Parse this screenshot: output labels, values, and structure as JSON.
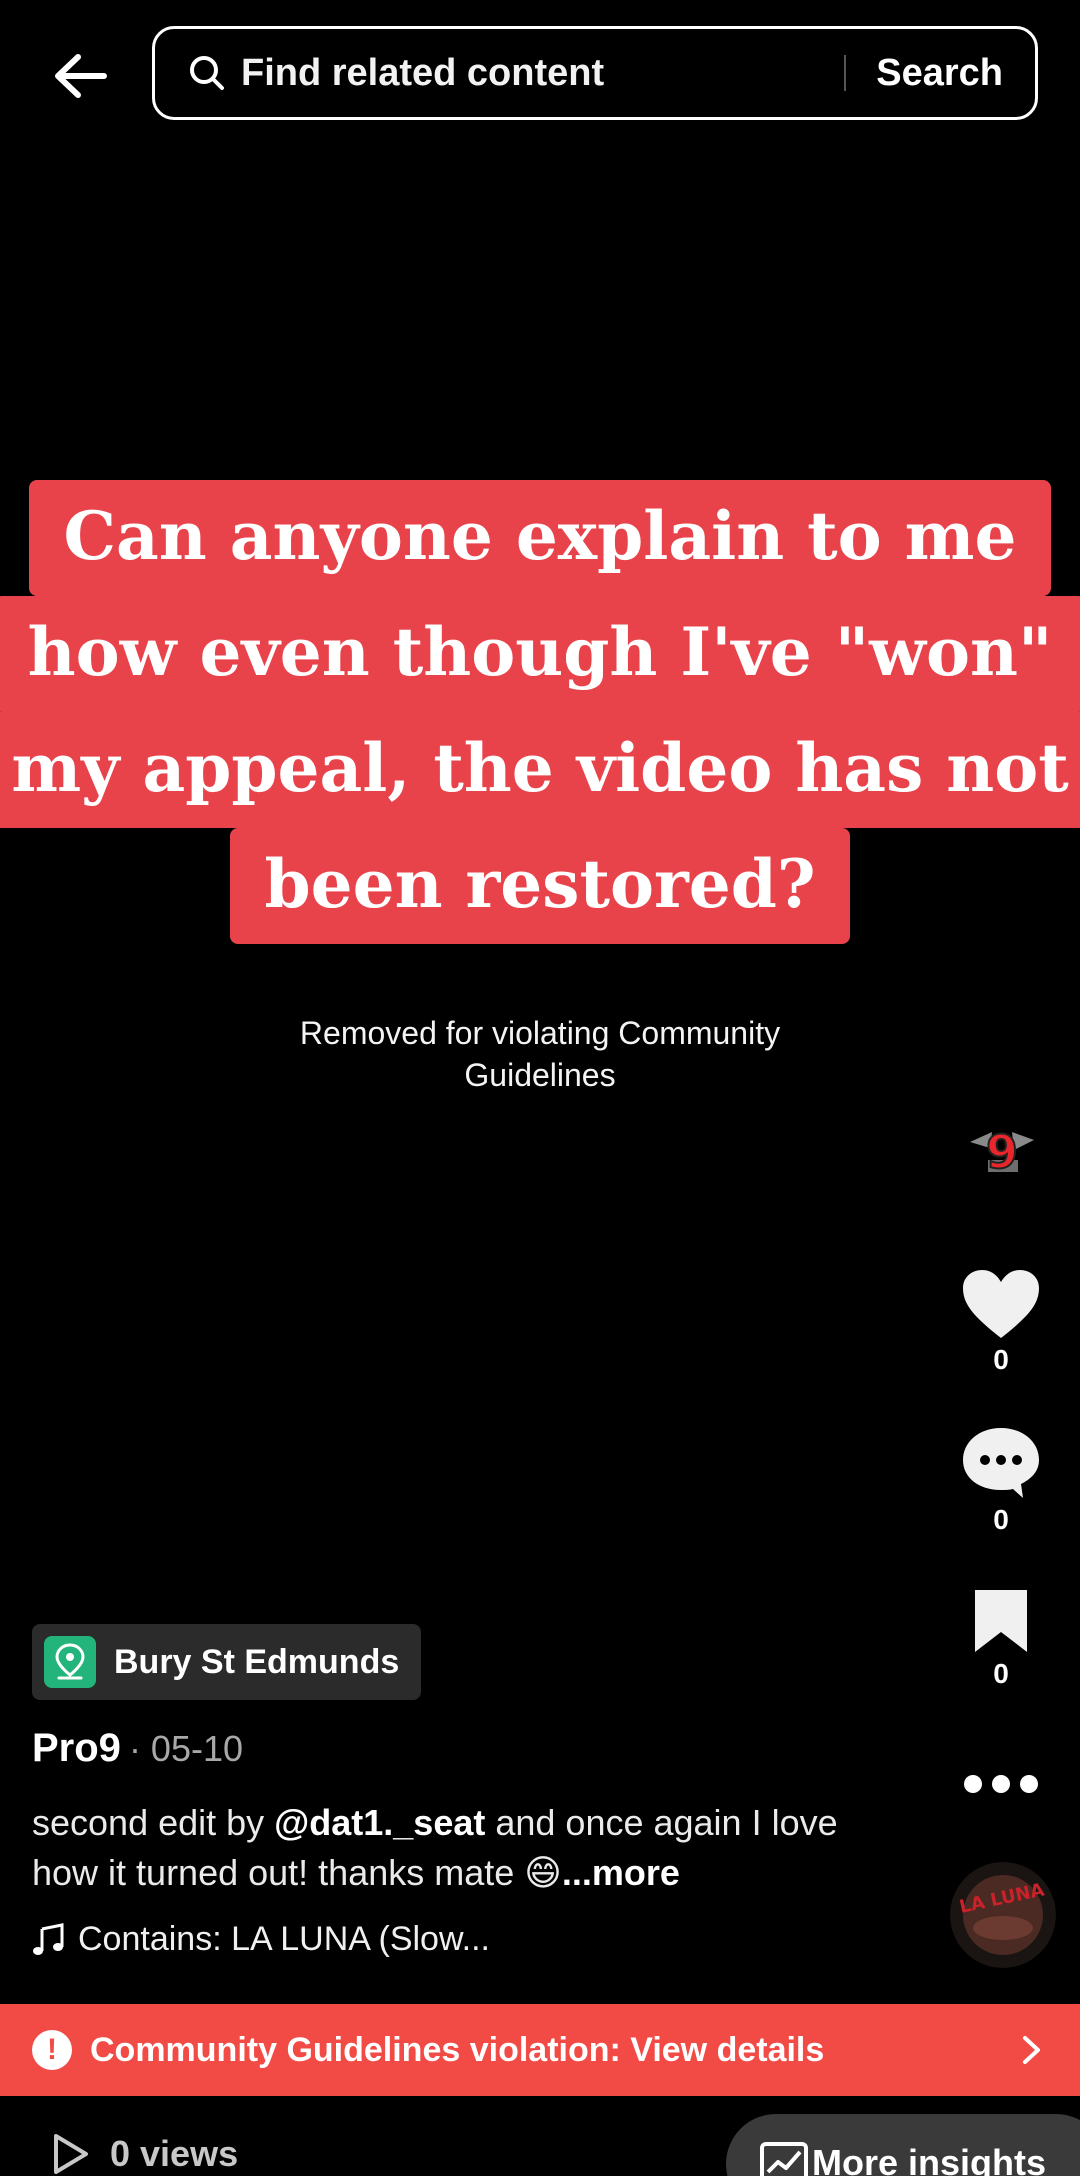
{
  "search": {
    "placeholder": "Find related content",
    "button": "Search"
  },
  "caption": {
    "lines": [
      "Can anyone explain to me",
      "how even though I've \"won\"",
      "my appeal, the video has not",
      "been restored?"
    ]
  },
  "status": {
    "removed_line1": "Removed for violating Community",
    "removed_line2": "Guidelines"
  },
  "rail": {
    "likes": "0",
    "comments": "0",
    "saves": "0"
  },
  "post": {
    "location": "Bury St Edmunds",
    "author": "Pro9",
    "date": "· 05-10",
    "desc_pre": "second edit by ",
    "desc_mention": "@dat1._seat",
    "desc_post": " and once again I love how it turned out! thanks mate 😄",
    "desc_more": "...more",
    "sound": "Contains: LA LUNA (Slow..."
  },
  "violation": {
    "text": "Community Guidelines violation: View details"
  },
  "footer": {
    "views": "0 views",
    "insights": "More insights"
  },
  "colors": {
    "caption_bg": "#e8434a",
    "violation_bg": "#f24a45",
    "location_pin": "#22b47a"
  }
}
